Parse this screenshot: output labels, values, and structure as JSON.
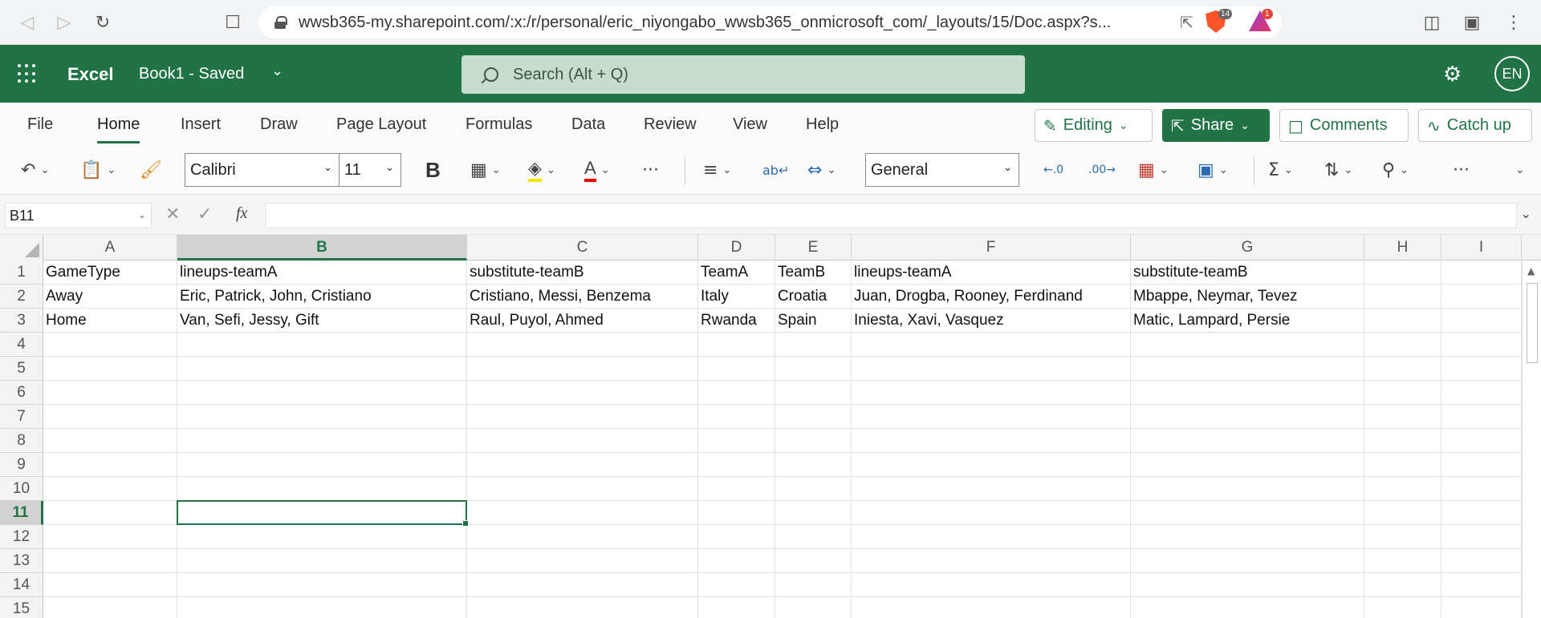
{
  "browser": {
    "url": "wwsb365-my.sharepoint.com/:x:/r/personal/eric_niyongabo_wwsb365_onmicrosoft_com/_layouts/15/Doc.aspx?s...",
    "brave_badge": "14",
    "rewards_badge": "1"
  },
  "header": {
    "app_name": "Excel",
    "doc_title": "Book1 - Saved",
    "search_placeholder": "Search (Alt + Q)",
    "avatar_initials": "EN",
    "brand_color": "#217346"
  },
  "ribbon": {
    "tabs": [
      "File",
      "Home",
      "Insert",
      "Draw",
      "Page Layout",
      "Formulas",
      "Data",
      "Review",
      "View",
      "Help"
    ],
    "active_tab": "Home",
    "editing_label": "Editing",
    "share_label": "Share",
    "comments_label": "Comments",
    "catchup_label": "Catch up",
    "font_name": "Calibri",
    "font_size": "11",
    "number_format": "General",
    "bold_label": "B",
    "more_label": "···"
  },
  "formula_bar": {
    "name_box": "B11",
    "fx_label": "fx",
    "formula": ""
  },
  "sheet": {
    "columns": [
      "A",
      "B",
      "C",
      "D",
      "E",
      "F",
      "G",
      "H",
      "I"
    ],
    "rows": [
      "1",
      "2",
      "3",
      "4",
      "5",
      "6",
      "7",
      "8",
      "9",
      "10",
      "11",
      "12",
      "13",
      "14",
      "15"
    ],
    "selected_column": "B",
    "selected_row": "11",
    "cells": [
      [
        "GameType",
        "lineups-teamA",
        "substitute-teamB",
        "TeamA",
        "TeamB",
        "lineups-teamA",
        "substitute-teamB",
        "",
        ""
      ],
      [
        "Away",
        "Eric, Patrick, John, Cristiano",
        "Cristiano, Messi, Benzema",
        "Italy",
        "Croatia",
        "Juan, Drogba, Rooney, Ferdinand",
        "Mbappe, Neymar, Tevez",
        "",
        ""
      ],
      [
        "Home",
        "Van, Sefi, Jessy, Gift",
        "Raul, Puyol, Ahmed",
        "Rwanda",
        "Spain",
        "Iniesta, Xavi, Vasquez",
        "Matic, Lampard, Persie",
        "",
        ""
      ]
    ]
  }
}
